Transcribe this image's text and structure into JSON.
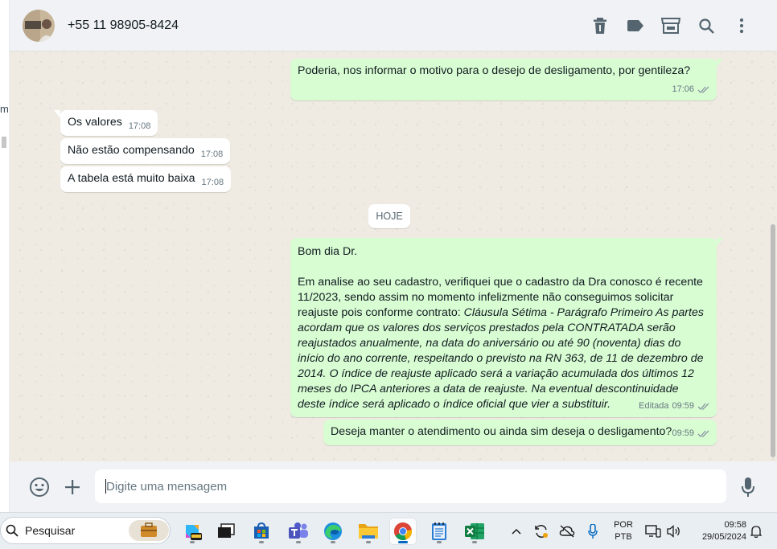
{
  "window": {
    "left_fragment": "m"
  },
  "header": {
    "contact_name": "+55 11 98905-8424"
  },
  "chat": {
    "messages": [
      {
        "direction": "out",
        "text": "Poderia, nos informar o motivo para o desejo de desligamento, por gentileza?",
        "time": "17:06"
      },
      {
        "direction": "in",
        "text": "Os valores",
        "time": "17:08"
      },
      {
        "direction": "in",
        "text": "Não estão compensando",
        "time": "17:08"
      },
      {
        "direction": "in",
        "text": "A tabela está muito baixa",
        "time": "17:08"
      }
    ],
    "day_separator": "HOJE",
    "long_message": {
      "greeting": "Bom dia Dr.",
      "body_start": "Em analise ao seu cadastro, verifiquei que o cadastro da Dra conosco é recente 11/2023, sendo assim no momento infelizmente não conseguimos solicitar reajuste pois conforme contrato: ",
      "body_italic": "Cláusula Sétima - Parágrafo Primeiro  As partes acordam que os valores dos serviços prestados pela CONTRATADA serão reajustados anualmente, na data do aniversário ou até 90 (noventa) dias do início do ano corrente, respeitando o previsto na RN 363, de 11 de dezembro de 2014. O índice de reajuste aplicado será a variação acumulada dos últimos 12 meses do IPCA anteriores a data de reajuste. Na eventual descontinuidade deste índice será aplicado o índice oficial que vier a substituir.",
      "edited_label": "Editada",
      "time": "09:59"
    },
    "last_message": {
      "text": "Deseja manter o atendimento ou ainda sim deseja o desligamento?",
      "time": "09:59"
    }
  },
  "composer": {
    "placeholder": "Digite uma mensagem"
  },
  "taskbar": {
    "search_label": "Pesquisar",
    "lang_line1": "POR",
    "lang_line2": "PTB",
    "time": "09:58",
    "date": "29/05/2024"
  },
  "colors": {
    "outgoing_bubble": "#d9fdd3",
    "incoming_bubble": "#ffffff",
    "chat_background": "#efeae2",
    "header_background": "#f0f2f5",
    "read_ticks": "#8696a0"
  }
}
